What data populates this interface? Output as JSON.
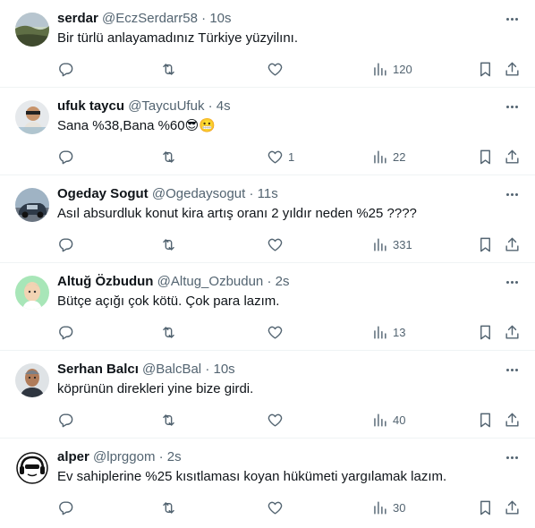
{
  "tweets": [
    {
      "name": "serdar",
      "handle": "@EczSerdarr58",
      "sep": "·",
      "time": "10s",
      "text": "Bir türlü anlayamadınız Türkiye yüzyilını.",
      "likes": "",
      "views": "120",
      "avatar": "landscape"
    },
    {
      "name": "ufuk taycu",
      "handle": "@TaycuUfuk",
      "sep": "·",
      "time": "4s",
      "text": "Sana %38,Bana %60😎😬",
      "likes": "1",
      "views": "22",
      "avatar": "person-beach"
    },
    {
      "name": "Ogeday Sogut",
      "handle": "@Ogedaysogut",
      "sep": "·",
      "time": "11s",
      "text": "Asıl absurdluk konut kira artış oranı 2 yıldır neden %25 ????",
      "likes": "",
      "views": "331",
      "avatar": "car-photo"
    },
    {
      "name": "Altuğ Özbudun",
      "handle": "@Altug_Ozbudun",
      "sep": "·",
      "time": "2s",
      "text": "Bütçe açığı çok kötü. Çok para lazım.",
      "likes": "",
      "views": "13",
      "avatar": "memoji"
    },
    {
      "name": "Serhan Balcı",
      "handle": "@BalcBal",
      "sep": "·",
      "time": "10s",
      "text": "köprünün direkleri yine bize girdi.",
      "likes": "",
      "views": "40",
      "avatar": "man-portrait"
    },
    {
      "name": "alper",
      "handle": "@lprggom",
      "sep": "·",
      "time": "2s",
      "text": "Ev sahiplerine %25 kısıtlaması koyan hükümeti yargılamak lazım.",
      "likes": "",
      "views": "30",
      "avatar": "headphones-face"
    }
  ]
}
